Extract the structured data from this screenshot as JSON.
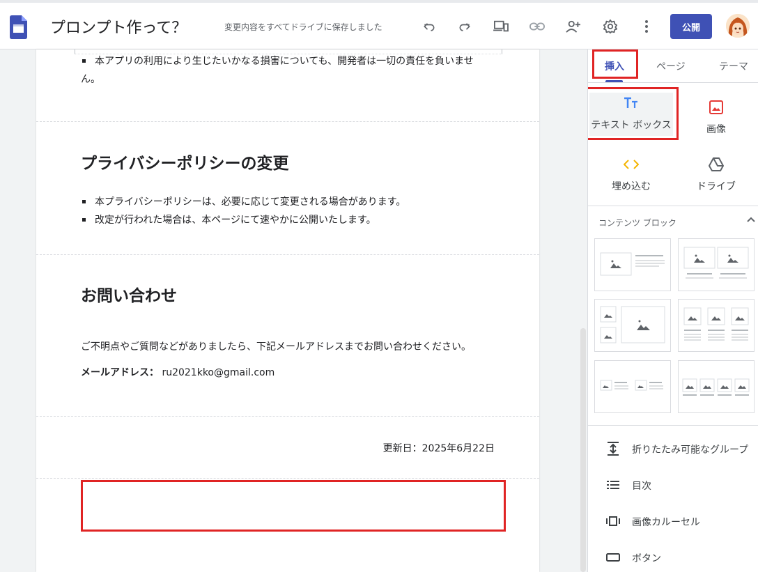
{
  "header": {
    "doc_title": "プロンプト作って？",
    "save_status": "変更内容をすべてドライブに保存しました",
    "publish_label": "公開"
  },
  "page": {
    "top_bullets": [
      "本アプリの利用により生じたいかなる損害についても、開発者は一切の責任を負いませ",
      "ん。"
    ],
    "privacy_change": {
      "heading": "プライバシーポリシーの変更",
      "bullets": [
        "本プライバシーポリシーは、必要に応じて変更される場合があります。",
        "改定が行われた場合は、本ページにて速やかに公開いたします。"
      ]
    },
    "contact": {
      "heading": "お問い合わせ",
      "paragraph": "ご不明点やご質問などがありましたら、下記メールアドレスまでお問い合わせください。",
      "email_label": "メールアドレス：",
      "email_value": "ru2021kko@gmail.com"
    },
    "update_date": "更新日：2025年6月22日"
  },
  "panel": {
    "tabs": [
      "挿入",
      "ページ",
      "テーマ"
    ],
    "insert_items": {
      "textbox": "テキスト ボックス",
      "image": "画像",
      "embed": "埋め込む",
      "drive": "ドライブ"
    },
    "content_blocks_title": "コンテンツ ブロック",
    "list_items": [
      "折りたたみ可能なグループ",
      "目次",
      "画像カルーセル",
      "ボタン"
    ]
  },
  "colors": {
    "accent": "#3f51b5",
    "highlight_red": "#e02424",
    "embed_icon": "#f4b400",
    "image_icon": "#e53935",
    "textbox_icon": "#4285f4"
  }
}
